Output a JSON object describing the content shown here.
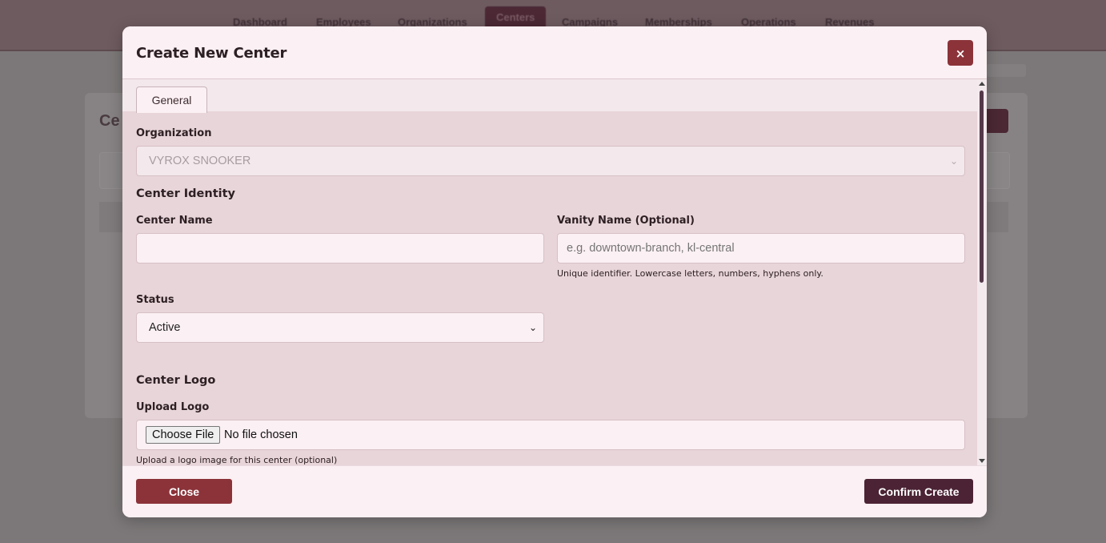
{
  "background": {
    "nav_items": [
      "Dashboard",
      "Employees",
      "Organizations",
      "Centers",
      "Campaigns",
      "Memberships",
      "Operations",
      "Revenues"
    ],
    "active_nav": "Centers",
    "page_title": "Ce"
  },
  "modal": {
    "title": "Create New Center",
    "close_icon": "×",
    "tabs": [
      {
        "label": "General",
        "active": true
      }
    ],
    "organization": {
      "label": "Organization",
      "value": "VYROX SNOOKER",
      "disabled": true
    },
    "center_identity": {
      "section_title": "Center Identity",
      "center_name": {
        "label": "Center Name",
        "value": "",
        "placeholder": ""
      },
      "vanity_name": {
        "label": "Vanity Name (Optional)",
        "value": "",
        "placeholder": "e.g. downtown-branch, kl-central",
        "hint": "Unique identifier. Lowercase letters, numbers, hyphens only."
      },
      "status": {
        "label": "Status",
        "value": "Active"
      }
    },
    "center_logo": {
      "section_title": "Center Logo",
      "upload": {
        "label": "Upload Logo",
        "button_label": "Choose File",
        "file_status": "No file chosen",
        "hint": "Upload a logo image for this center (optional)"
      }
    },
    "footer": {
      "close_label": "Close",
      "confirm_label": "Confirm Create"
    }
  },
  "colors": {
    "accent_red": "#8b3339",
    "accent_dark": "#4b2334",
    "modal_bg": "#fbf0f3",
    "body_bg": "#e8d5d9"
  }
}
